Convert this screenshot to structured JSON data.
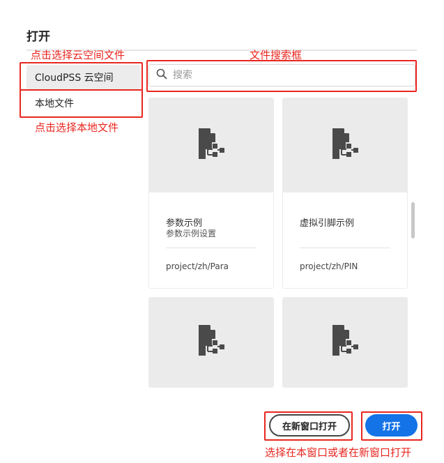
{
  "dialog": {
    "title": "打开"
  },
  "annotations": {
    "cloud_hint": "点击选择云空间文件",
    "local_hint": "点击选择本地文件",
    "search_hint": "文件搜索框",
    "open_hint": "选择在本窗口或者在新窗口打开"
  },
  "sidebar": {
    "items": [
      {
        "label": "CloudPSS 云空间",
        "selected": true
      },
      {
        "label": "本地文件",
        "selected": false
      }
    ]
  },
  "search": {
    "placeholder": "搜索",
    "value": ""
  },
  "files": [
    {
      "name": "参数示例",
      "description": "参数示例设置",
      "path": "project/zh/Para"
    },
    {
      "name": "虚拟引脚示例",
      "description": "",
      "path": "project/zh/PIN"
    },
    {
      "name": "",
      "description": "",
      "path": ""
    },
    {
      "name": "",
      "description": "",
      "path": ""
    }
  ],
  "actions": {
    "open_new_window": "在新窗口打开",
    "open": "打开"
  },
  "colors": {
    "annotation_red": "#e8261f",
    "primary_blue": "#1473e6",
    "thumb_bg": "#ebebeb",
    "icon_dark": "#4a4a4a"
  },
  "icons": {
    "search": "search-icon",
    "file": "file-tree-icon"
  }
}
